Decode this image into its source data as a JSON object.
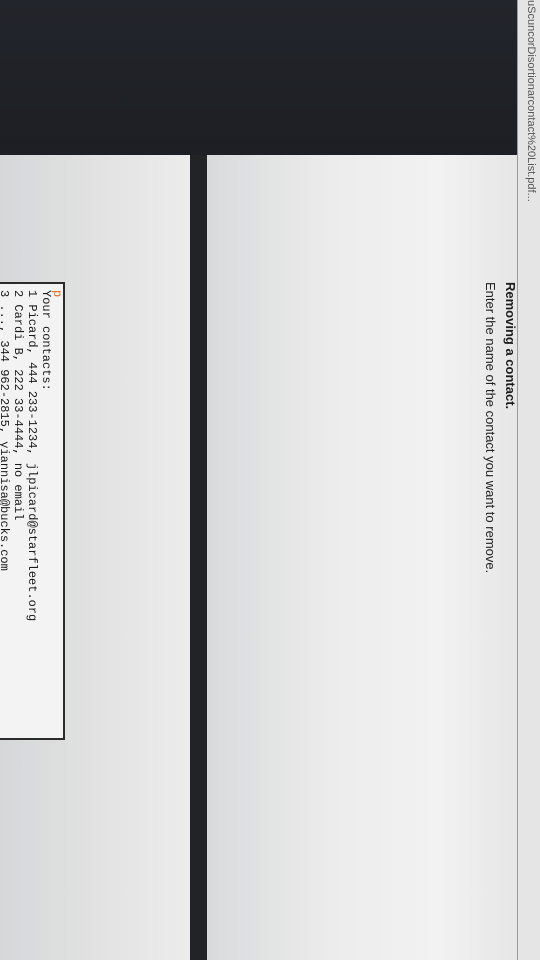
{
  "window": {
    "filename": "...uScuncorDisortionarcontact%20List.pdf"
  },
  "document": {
    "heading": "Removing a contact.",
    "instruction": "Enter the name of the contact you want to remove."
  },
  "console": {
    "prompt": "p",
    "lines": [
      "Your contacts:",
      "1 Picard,  444 233-1234, jlpicard@starfleet.org",
      "2 Cardi B,   222 33-4444, no email",
      "3 ...,       344 962-2815, yiannisa@bucks.com"
    ]
  }
}
